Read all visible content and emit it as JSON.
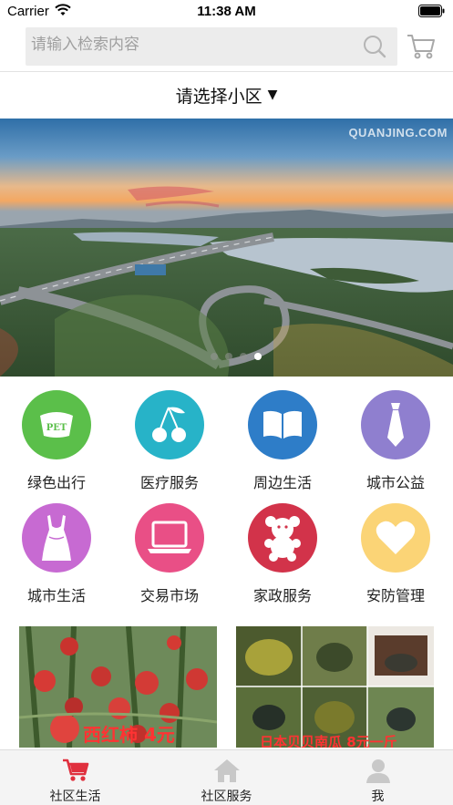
{
  "status": {
    "carrier": "Carrier",
    "time": "11:38 AM"
  },
  "search": {
    "placeholder": "请输入检索内容"
  },
  "community": {
    "label": "请选择小区",
    "arrow": "▼"
  },
  "banner": {
    "watermark": "QUANJING.COM",
    "dot_count": 4,
    "active_dot": 3
  },
  "services": [
    {
      "label": "绿色出行",
      "icon": "pet-bowl-icon",
      "color": "#5bbf4a"
    },
    {
      "label": "医疗服务",
      "icon": "cherry-icon",
      "color": "#27b3c8"
    },
    {
      "label": "周边生活",
      "icon": "book-icon",
      "color": "#2e7dc8"
    },
    {
      "label": "城市公益",
      "icon": "tie-icon",
      "color": "#8f7fcf"
    },
    {
      "label": "城市生活",
      "icon": "dress-icon",
      "color": "#c76ad2"
    },
    {
      "label": "交易市场",
      "icon": "laptop-icon",
      "color": "#e94f86"
    },
    {
      "label": "家政服务",
      "icon": "teddy-bear-icon",
      "color": "#d2334a"
    },
    {
      "label": "安防管理",
      "icon": "heart-icon",
      "color": "#fbd476"
    }
  ],
  "products": [
    {
      "caption": "西红柿 4元"
    },
    {
      "caption": "日本贝贝南瓜 8元一斤"
    }
  ],
  "tabs": [
    {
      "label": "社区生活",
      "icon": "cart-icon",
      "active": true
    },
    {
      "label": "社区服务",
      "icon": "home-icon",
      "active": false
    },
    {
      "label": "我",
      "icon": "person-icon",
      "active": false
    }
  ],
  "colors": {
    "accent": "#e0303e",
    "tab_inactive": "#c8c8c8"
  }
}
